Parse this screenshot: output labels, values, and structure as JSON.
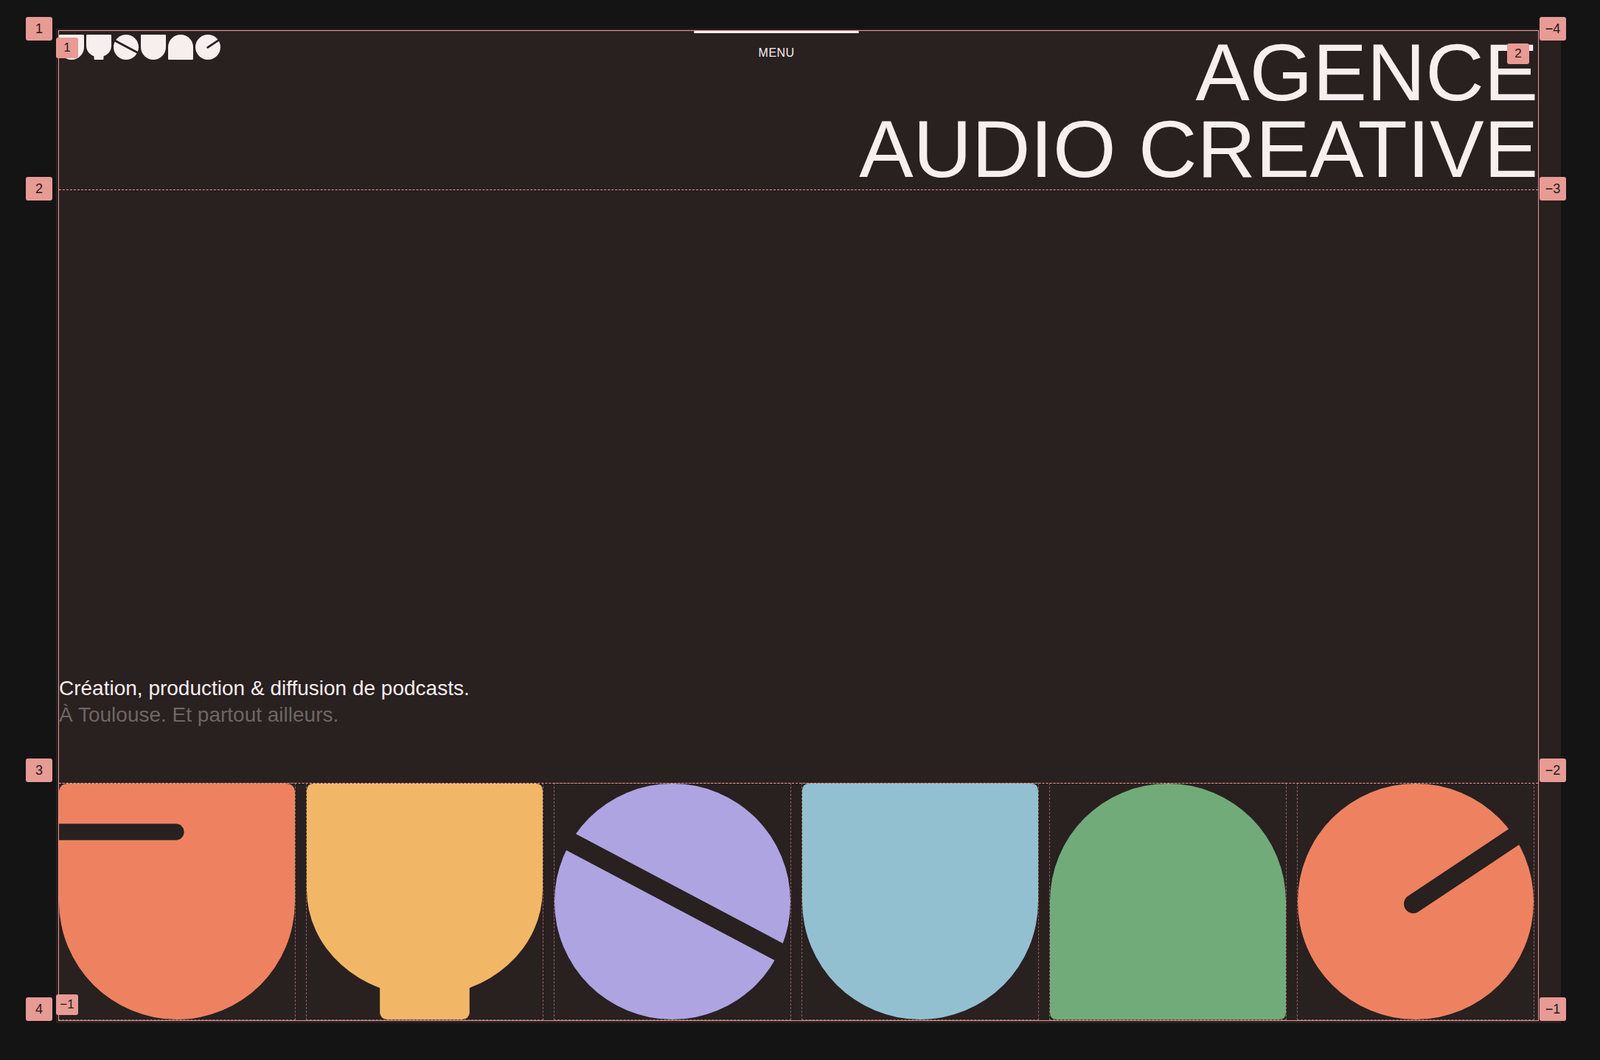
{
  "header": {
    "menu": "MENU"
  },
  "hero": {
    "title_lines": [
      "AGENCE",
      "AUDIO CREATIVE"
    ],
    "tagline": "Création, production & diffusion de podcasts.",
    "subline": "À Toulouse. Et partout ailleurs."
  },
  "shapes": [
    {
      "kind": "slot",
      "color": "#ee8260"
    },
    {
      "kind": "cup",
      "color": "#f2b766"
    },
    {
      "kind": "split-circle",
      "color": "#aea4e2"
    },
    {
      "kind": "u",
      "color": "#93c0d1"
    },
    {
      "kind": "arch",
      "color": "#72ab7a"
    },
    {
      "kind": "notch-circle",
      "color": "#ee8260"
    }
  ],
  "grid_overlay": {
    "row_badges_left": [
      "1",
      "2",
      "3",
      "4"
    ],
    "row_badges_right": [
      "−4",
      "−3",
      "−2",
      "−1"
    ],
    "column_badges_top": [
      "1",
      "2"
    ],
    "column_badges_bottom": [
      "−1"
    ]
  }
}
